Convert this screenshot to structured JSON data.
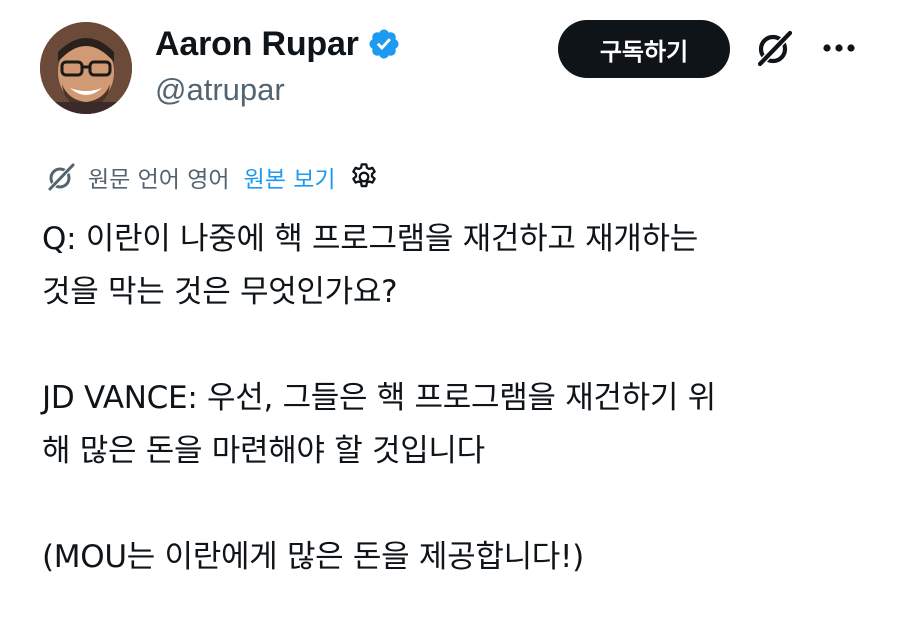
{
  "author": {
    "display_name": "Aaron Rupar",
    "handle": "@atrupar",
    "verified": true,
    "verified_color": "#1d9bf0"
  },
  "actions": {
    "subscribe_label": "구독하기",
    "grok_icon": "grok-icon",
    "more_icon": "more-horizontal-icon"
  },
  "translation": {
    "label": "원문 언어 영어",
    "show_original": "원본 보기",
    "link_color": "#1d9bf0"
  },
  "tweet": {
    "line1": "Q: 이란이 나중에 핵 프로그램을 재건하고 재개하는",
    "line2": "것을 막는 것은 무엇인가요?",
    "line3": "JD VANCE: 우선, 그들은 핵 프로그램을 재건하기 위",
    "line4": "해 많은 돈을 마련해야 할 것입니다",
    "line5": "(MOU는 이란에게 많은 돈을 제공합니다!)"
  }
}
